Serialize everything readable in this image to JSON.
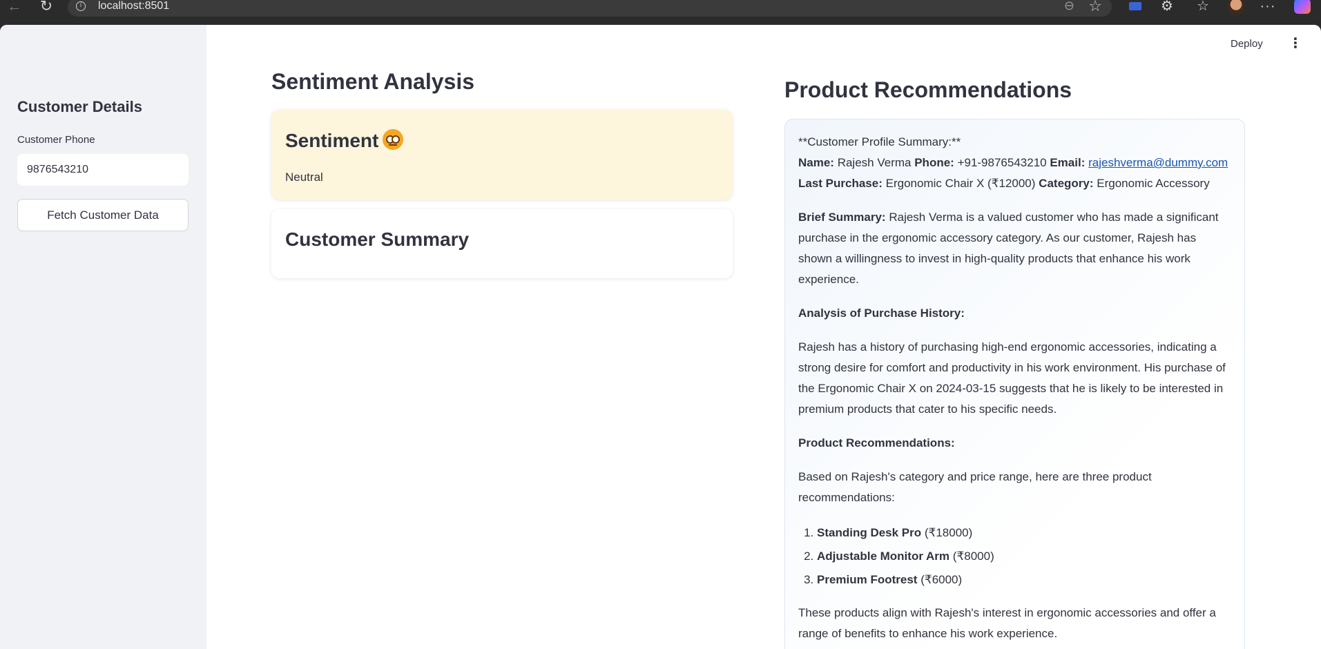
{
  "browser": {
    "url": "localhost:8501"
  },
  "header": {
    "deploy_label": "Deploy",
    "menu_icon": "kebab-menu-icon"
  },
  "sidebar": {
    "title": "Customer Details",
    "phone_label": "Customer Phone",
    "phone_value": "9876543210",
    "fetch_button": "Fetch Customer Data"
  },
  "sentiment": {
    "heading": "Sentiment Analysis",
    "card_title": "Sentiment",
    "emoji_icon": "neutral-face-icon",
    "value": "Neutral",
    "summary_title": "Customer Summary"
  },
  "recommendations": {
    "heading": "Product Recommendations",
    "profile_header": "**Customer Profile Summary:**",
    "name_label": "Name:",
    "name_value": "Rajesh Verma",
    "phone_label": "Phone:",
    "phone_value": "+91-9876543210",
    "email_label": "Email:",
    "email_value": "rajeshverma@dummy.com",
    "last_purchase_label": "Last Purchase:",
    "last_purchase_value": "Ergonomic Chair X (₹12000)",
    "category_label": "Category:",
    "category_value": "Ergonomic Accessory",
    "brief_label": "Brief Summary:",
    "brief_text": "Rajesh Verma is a valued customer who has made a significant purchase in the ergonomic accessory category. As our customer, Rajesh has shown a willingness to invest in high-quality products that enhance his work experience.",
    "analysis_heading": "Analysis of Purchase History:",
    "analysis_text": "Rajesh has a history of purchasing high-end ergonomic accessories, indicating a strong desire for comfort and productivity in his work environment. His purchase of the Ergonomic Chair X on 2024-03-15 suggests that he is likely to be interested in premium products that cater to his specific needs.",
    "reco_heading": "Product Recommendations:",
    "reco_intro": "Based on Rajesh's category and price range, here are three product recommendations:",
    "items": [
      {
        "name": "Standing Desk Pro",
        "price": "(₹18000)"
      },
      {
        "name": "Adjustable Monitor Arm",
        "price": "(₹8000)"
      },
      {
        "name": "Premium Footrest",
        "price": "(₹6000)"
      }
    ],
    "closing_text": "These products align with Rajesh's interest in ergonomic accessories and offer a range of benefits to enhance his work experience."
  }
}
